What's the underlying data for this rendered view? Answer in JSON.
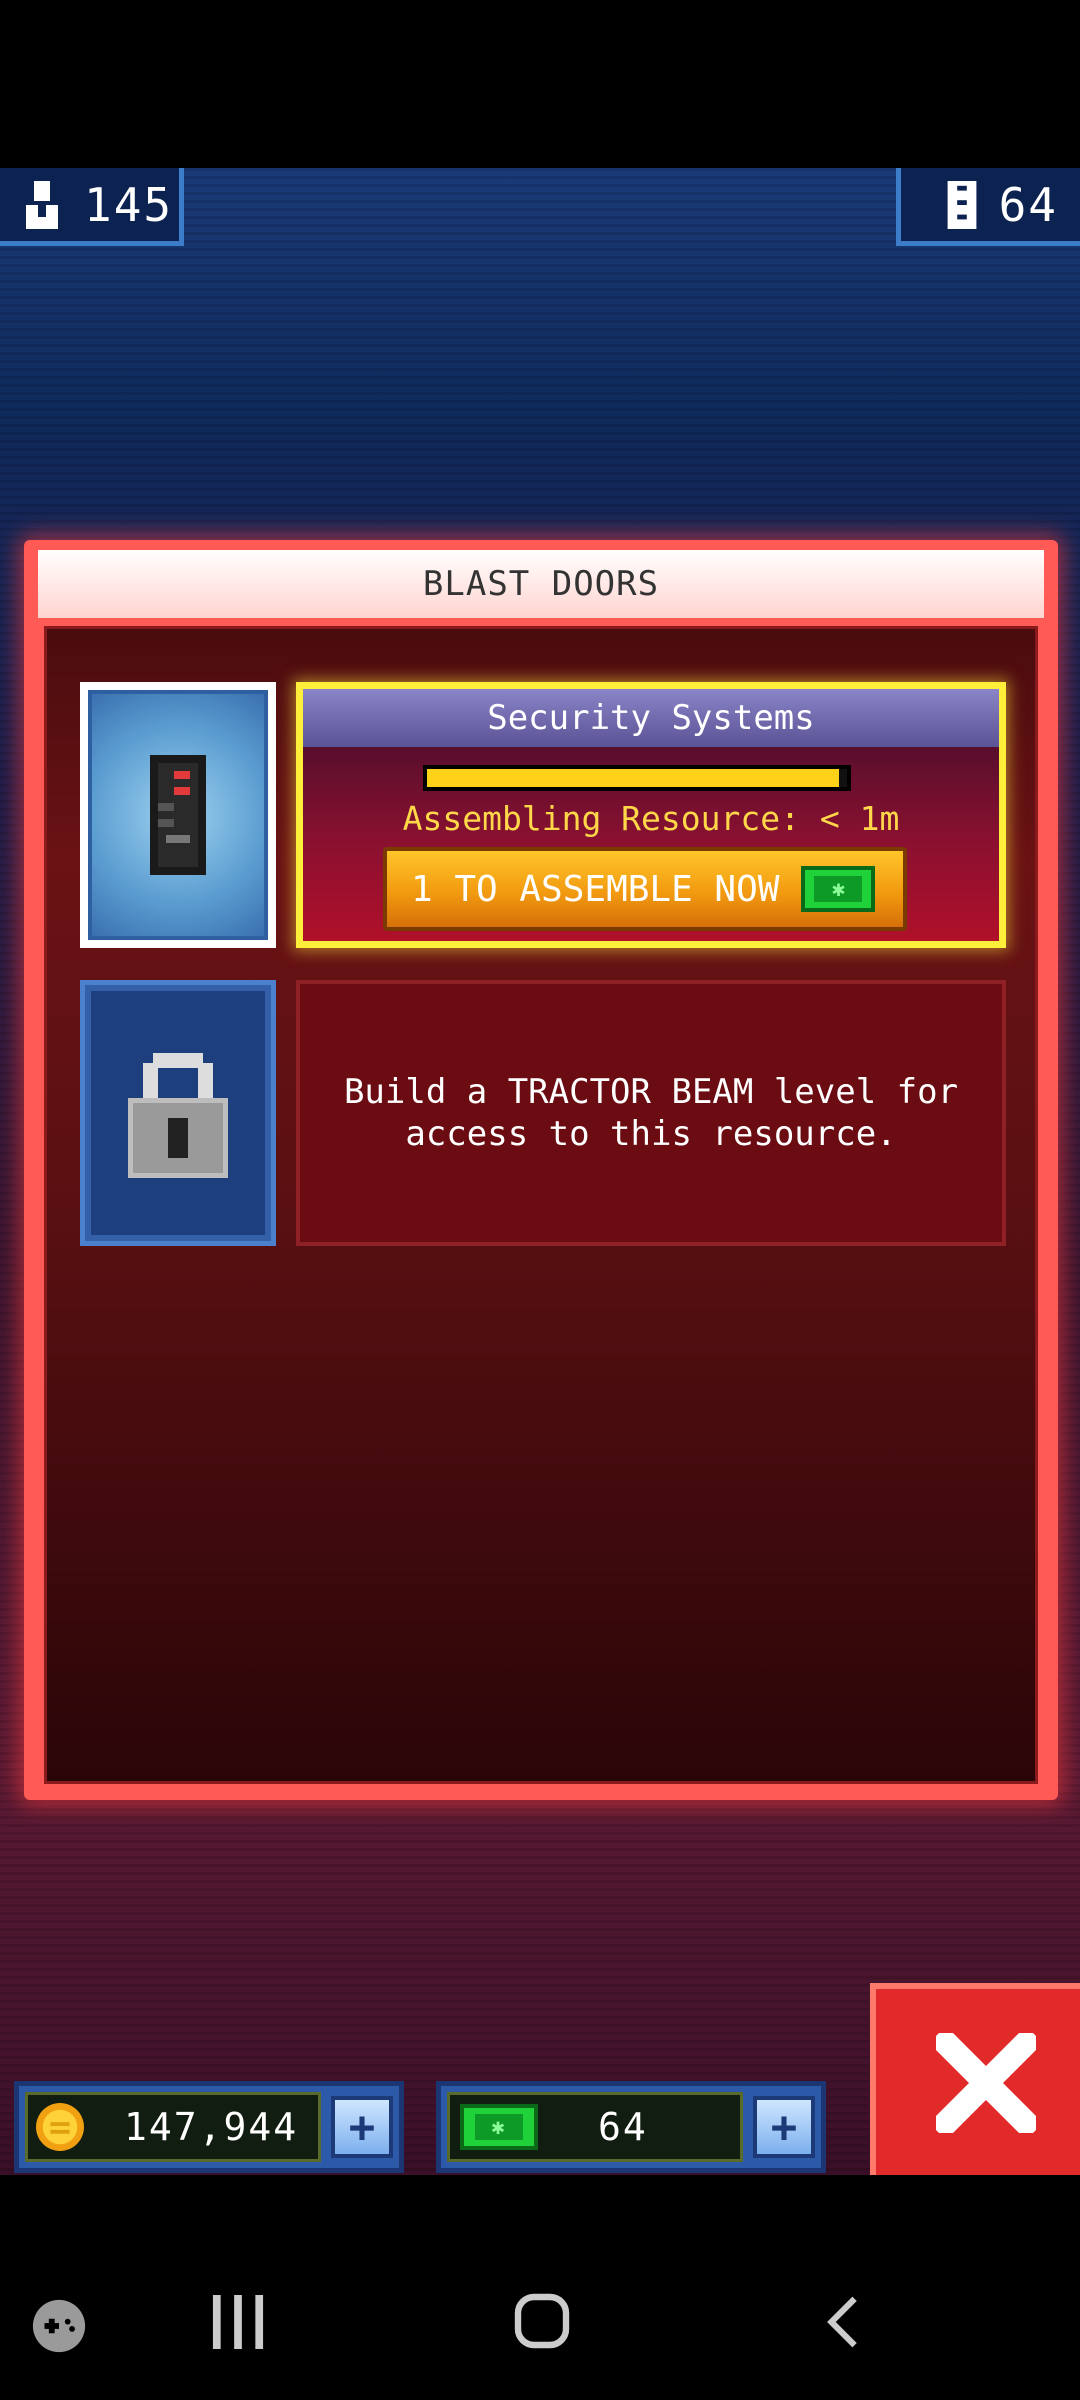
{
  "top": {
    "crew_count": "145",
    "rooms_count": "64"
  },
  "panel": {
    "title": "BLAST DOORS",
    "resource": {
      "name": "Security Systems",
      "status": "Assembling Resource: < 1m",
      "progress": 0.98,
      "assemble_label": "1 TO ASSEMBLE NOW"
    },
    "locked_message": "Build a TRACTOR BEAM level for access to this resource."
  },
  "bottom": {
    "coins": "147,944",
    "bux": "64"
  },
  "colors": {
    "panel_border": "#ff5a55",
    "gem_green": "#1fd23a",
    "progress_yellow": "#ffd21a"
  },
  "icons": [
    "crew-icon",
    "rooms-icon",
    "security-system-icon",
    "padlock-icon",
    "coin-icon",
    "bux-icon",
    "plus-icon",
    "close-icon"
  ]
}
